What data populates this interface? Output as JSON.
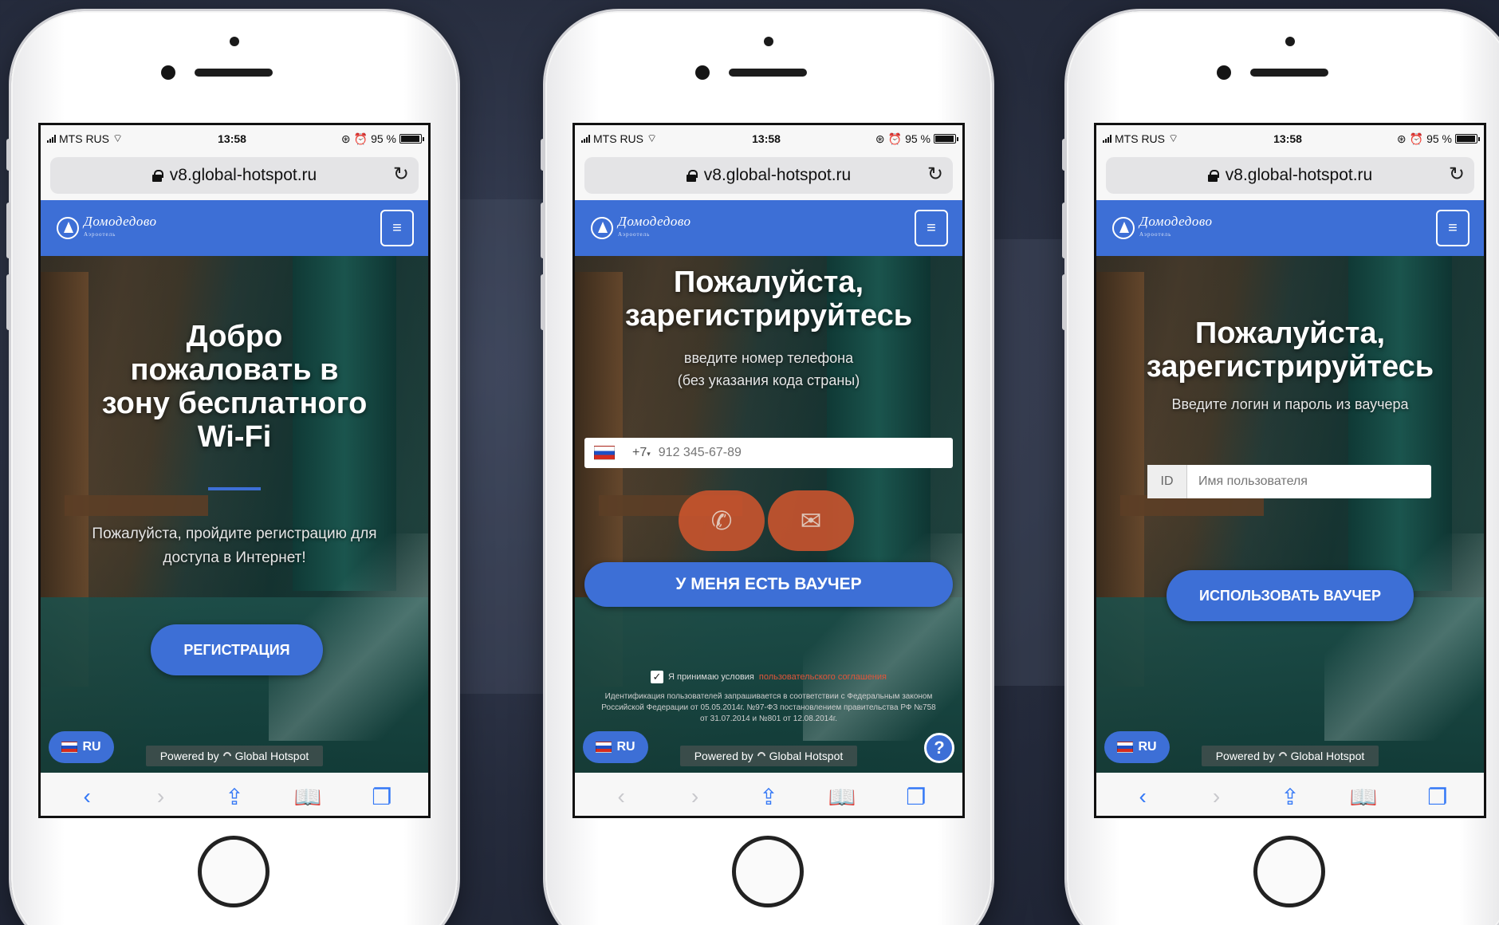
{
  "status": {
    "carrier": "MTS RUS",
    "time": "13:58",
    "battery": "95 %",
    "battery_level": 0.95
  },
  "browser": {
    "url": "v8.global-hotspot.ru"
  },
  "brand": {
    "name": "Домодедово",
    "subtitle": "Аэроотель",
    "accent": "#3d6fd6"
  },
  "footer": {
    "lang": "RU",
    "powered_prefix": "Powered by",
    "powered_brand": "Global Hotspot"
  },
  "screens": [
    {
      "title_lines": [
        "Добро",
        "пожаловать в",
        "зону бесплатного",
        "Wi-Fi"
      ],
      "subtitle": "Пожалуйста, пройдите регистрацию для доступа в Интернет!",
      "button": "РЕГИСТРАЦИЯ"
    },
    {
      "title_lines": [
        "Пожалуйста,",
        "зарегистрируйтесь"
      ],
      "hint_lines": [
        "введите номер телефона",
        "(без указания кода страны)"
      ],
      "phone_code": "+7",
      "phone_placeholder": "912 345-67-89",
      "voucher_button": "У МЕНЯ ЕСТЬ ВАУЧЕР",
      "agree_prefix": "Я принимаю условия",
      "agree_link": "пользовательского соглашения",
      "legal": "Идентификация пользователей запрашивается в соответствии с Федеральным законом Российской Федерации от 05.05.2014г. №97-ФЗ постановлением правительства РФ №758 от 31.07.2014 и №801 от 12.08.2014г.",
      "help": "?"
    },
    {
      "title_lines": [
        "Пожалуйста,",
        "зарегистрируйтесь"
      ],
      "hint": "Введите логин и пароль из ваучера",
      "id_label": "ID",
      "username_placeholder": "Имя пользователя",
      "button": "ИСПОЛЬЗОВАТЬ ВАУЧЕР"
    }
  ]
}
